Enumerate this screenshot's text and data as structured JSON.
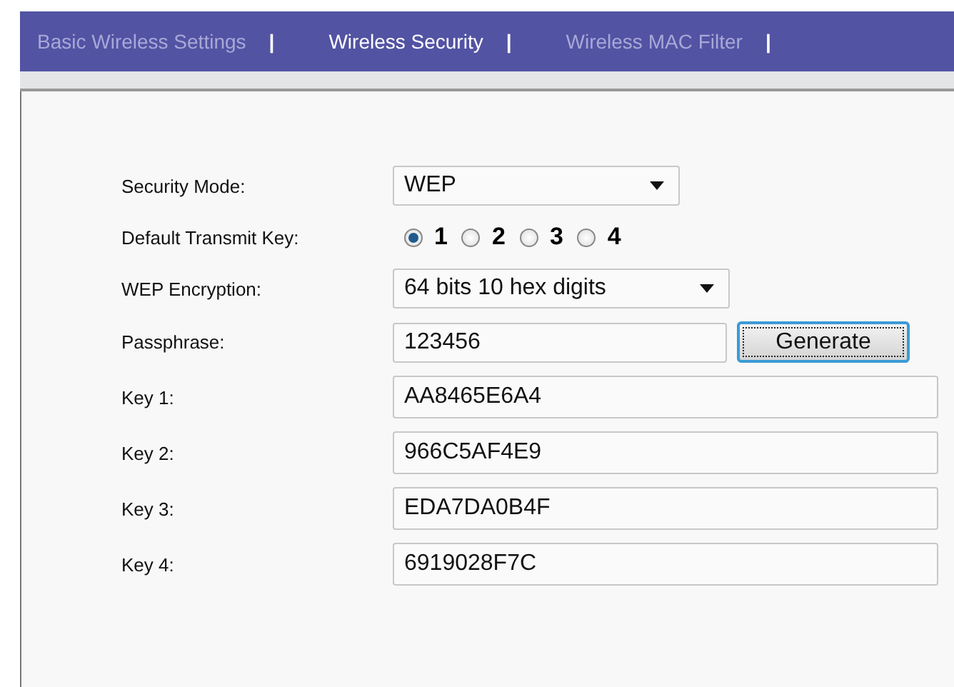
{
  "tabs": [
    {
      "label": "Basic Wireless Settings",
      "selected": false,
      "separator": "|"
    },
    {
      "label": "Wireless Security",
      "selected": true,
      "separator": "|"
    },
    {
      "label": "Wireless MAC Filter",
      "selected": false,
      "separator": "|"
    }
  ],
  "form": {
    "security_mode": {
      "label": "Security Mode:",
      "value": "WEP"
    },
    "transmit_key": {
      "label": "Default Transmit  Key:",
      "options": [
        {
          "label": "1",
          "selected": true
        },
        {
          "label": "2",
          "selected": false
        },
        {
          "label": "3",
          "selected": false
        },
        {
          "label": "4",
          "selected": false
        }
      ]
    },
    "encryption": {
      "label": "WEP Encryption:",
      "value": "64 bits 10 hex digits"
    },
    "passphrase": {
      "label": "Passphrase:",
      "value": "123456",
      "button": "Generate"
    },
    "keys": [
      {
        "label": "Key 1:",
        "value": "AA8465E6A4"
      },
      {
        "label": "Key 2:",
        "value": "966C5AF4E9"
      },
      {
        "label": "Key 3:",
        "value": "EDA7DA0B4F"
      },
      {
        "label": "Key 4:",
        "value": "6919028F7C"
      }
    ]
  }
}
